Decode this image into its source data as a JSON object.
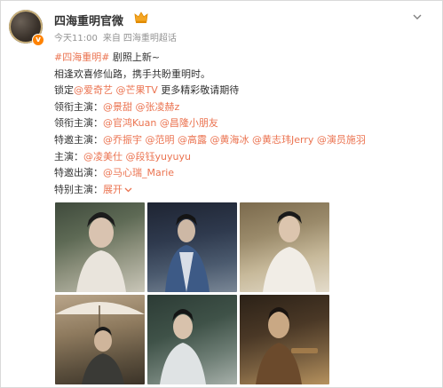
{
  "account": {
    "name": "四海重明官微",
    "time": "今天11:00",
    "source_prefix": "来自",
    "source": "四海重明超话"
  },
  "post": {
    "hashtag": "#四海重明#",
    "line1_rest": " 剧照上新~",
    "line2": "相逢欢喜修仙路，携手共盼重明时。",
    "line3_prefix": "锁定",
    "line3_link1": "@爱奇艺",
    "line3_link2": "@芒果TV",
    "line3_suffix": " 更多精彩敬请期待",
    "rows": [
      {
        "label": "领衔主演：",
        "links": [
          "@景甜",
          "@张凌赫z"
        ]
      },
      {
        "label": "领衔主演：",
        "links": [
          "@官鸿Kuan",
          "@昌隆小朋友"
        ]
      },
      {
        "label": "特邀主演：",
        "links": [
          "@乔振宇",
          "@范明",
          "@高露",
          "@黄海冰",
          "@黄志玮Jerry",
          "@演员施羽"
        ]
      },
      {
        "label": "主演：",
        "links": [
          "@凌美仕",
          "@段钰yuyuyu"
        ]
      },
      {
        "label": "特邀出演：",
        "links": [
          "@马心瑞_Marie"
        ]
      }
    ],
    "special_label": "特别主演：",
    "expand_label": "展开"
  },
  "photos": [
    "photo-1",
    "photo-2",
    "photo-3",
    "photo-4",
    "photo-5",
    "photo-6"
  ],
  "colors": {
    "link": "#eb7350",
    "meta": "#939393",
    "badge": "#ff8200"
  }
}
